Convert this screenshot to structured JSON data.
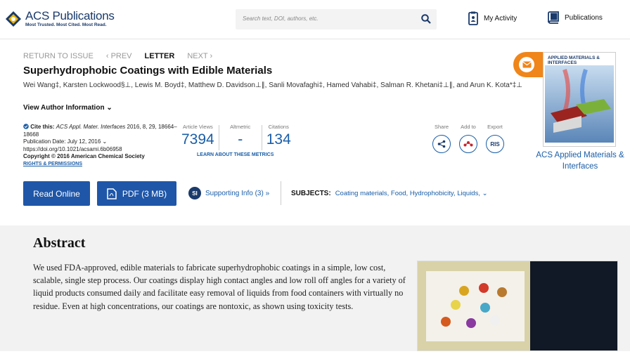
{
  "header": {
    "logo_name": "ACS Publications",
    "logo_tagline": "Most Trusted. Most Cited. Most Read.",
    "search_placeholder": "Search text, DOI, authors, etc.",
    "my_activity": "My Activity",
    "publications": "Publications"
  },
  "nav": {
    "return": "RETURN TO ISSUE",
    "prev": "‹ PREV",
    "current": "LETTER",
    "next": "NEXT ›"
  },
  "article": {
    "title": "Superhydrophobic Coatings with Edible Materials",
    "authors": "Wei Wang‡, Karsten Lockwood§⊥, Lewis M. Boyd‡, Matthew D. Davidson⊥∥, Sanli Movafaghi‡, Hamed Vahabi‡, Salman R. Khetani‡⊥∥, and Arun K. Kota*‡⊥",
    "view_author": "View Author Information ⌄",
    "cite_label": "Cite this:",
    "cite_journal": "ACS Appl. Mater. Interfaces",
    "cite_rest": " 2016, 8, 29, 18664–18668",
    "pub_date": "Publication Date: July 12, 2016 ⌄",
    "doi": "https://doi.org/10.1021/acsami.6b06958",
    "copyright": "Copyright © 2016 American Chemical Society",
    "rights": "RIGHTS & PERMISSIONS"
  },
  "metrics": {
    "views_label": "Article Views",
    "views": "7394",
    "altmetric_label": "Altmetric",
    "altmetric": "-",
    "citations_label": "Citations",
    "citations": "134",
    "learn": "LEARN ABOUT THESE METRICS"
  },
  "actions": {
    "share": "Share",
    "add": "Add to",
    "export": "Export",
    "ris": "RIS"
  },
  "buttons": {
    "read": "Read Online",
    "pdf": "PDF (3 MB)",
    "si": "SI",
    "supporting": "Supporting Info (3) »"
  },
  "subjects": {
    "label": "SUBJECTS:",
    "list": "Coating materials, Food, Hydrophobicity, Liquids, ⌄"
  },
  "journal": {
    "cover_title": "APPLIED MATERIALS & INTERFACES",
    "name": "ACS Applied Materials & Interfaces"
  },
  "abstract": {
    "heading": "Abstract",
    "text": "We used FDA-approved, edible materials to fabricate superhydrophobic coatings in a simple, low cost, scalable, single step process. Our coatings display high contact angles and low roll off angles for a variety of liquid products consumed daily and facilitate easy removal of liquids from food containers with virtually no residue. Even at high concentrations, our coatings are nontoxic, as shown using toxicity tests."
  },
  "colors": {
    "brand_blue": "#1f56a8",
    "orange": "#f08519"
  }
}
